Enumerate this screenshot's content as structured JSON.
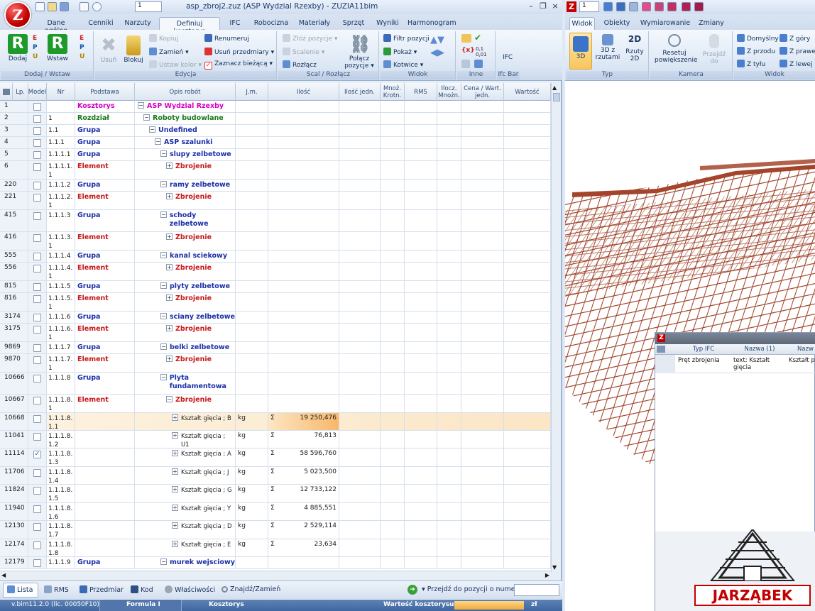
{
  "app": {
    "title": "asp_zbroj2.zuz (ASP Wydzial Rzexby) - ZUZIA11bim",
    "logo": "Z",
    "qat_number": "1"
  },
  "tabs": [
    "Dane ogólne",
    "Cenniki",
    "Narzuty",
    "Definiuj kosztorys",
    "IFC",
    "Robocizna",
    "Materiały",
    "Sprzęt",
    "Wyniki",
    "Harmonogram"
  ],
  "active_tab": "Definiuj kosztorys",
  "ribbon": {
    "groups": [
      "Dodaj / Wstaw",
      "Edycja",
      "Scal / Rozłącz",
      "Widok",
      "Inne",
      "Ifc Bar"
    ],
    "dodaj": "Dodaj",
    "wstaw": "Wstaw",
    "usun": "Usuń",
    "blokuj": "Blokuj",
    "kopiuj": "Kopiuj",
    "zamien": "Zamień",
    "ustaw_kolor": "Ustaw kolor",
    "renumeruj": "Renumeruj",
    "usun_przedmiary": "Usuń przedmiary",
    "zaznacz_biezaca": "Zaznacz bieżącą",
    "zloz_pozycje": "Złóż pozycje",
    "scalenie": "Scalenie",
    "rozlacz": "Rozłącz",
    "polacz_pozycje": "Połącz pozycje",
    "filtr_pozycji": "Filtr pozycji",
    "pokaz": "Pokaż",
    "kotwice": "Kotwice",
    "ifc": "IFC"
  },
  "columns": [
    "Lp.",
    "Model",
    "Nr",
    "Podstawa",
    "Opis robót",
    "J.m.",
    "Ilość",
    "Ilość jedn.",
    "Mnoż. Krotn.",
    "RMS",
    "Ilocz. Mnożn.",
    "Cena / Wart. jedn.",
    "Wartość"
  ],
  "rows": [
    {
      "lp": "1",
      "nr": "",
      "pd": "Kosztorys",
      "op": "ASP Wydzial Rzexby",
      "ind": 0,
      "exp": "⊟",
      "type": "k",
      "jm": "",
      "il": "",
      "chk": false
    },
    {
      "lp": "2",
      "nr": "1",
      "pd": "Rozdział",
      "op": "Roboty budowlane",
      "ind": 1,
      "exp": "⊟",
      "type": "r",
      "jm": "",
      "il": "",
      "chk": false
    },
    {
      "lp": "3",
      "nr": "1.1",
      "pd": "Grupa",
      "op": "Undefined",
      "ind": 2,
      "exp": "⊟",
      "type": "g",
      "jm": "",
      "il": "",
      "chk": false
    },
    {
      "lp": "4",
      "nr": "1.1.1",
      "pd": "Grupa",
      "op": "ASP szalunki",
      "ind": 3,
      "exp": "⊟",
      "type": "g",
      "jm": "",
      "il": "",
      "chk": false
    },
    {
      "lp": "5",
      "nr": "1.1.1.1",
      "pd": "Grupa",
      "op": "slupy zelbetowe",
      "ind": 4,
      "exp": "⊟",
      "type": "g",
      "jm": "",
      "il": "",
      "chk": false
    },
    {
      "lp": "6",
      "nr": "1.1.1.1.1",
      "pd": "Element",
      "op": "Zbrojenie",
      "ind": 5,
      "exp": "⊞",
      "type": "e",
      "jm": "",
      "il": "",
      "chk": false
    },
    {
      "lp": "220",
      "nr": "1.1.1.2",
      "pd": "Grupa",
      "op": "ramy zelbetowe",
      "ind": 4,
      "exp": "⊟",
      "type": "g",
      "jm": "",
      "il": "",
      "chk": false
    },
    {
      "lp": "221",
      "nr": "1.1.1.2.1",
      "pd": "Element",
      "op": "Zbrojenie",
      "ind": 5,
      "exp": "⊞",
      "type": "e",
      "jm": "",
      "il": "",
      "chk": false
    },
    {
      "lp": "415",
      "nr": "1.1.1.3",
      "pd": "Grupa",
      "op": "schody zelbetowe",
      "ind": 4,
      "exp": "⊟",
      "type": "g",
      "jm": "",
      "il": "",
      "chk": false
    },
    {
      "lp": "416",
      "nr": "1.1.1.3.1",
      "pd": "Element",
      "op": "Zbrojenie",
      "ind": 5,
      "exp": "⊞",
      "type": "e",
      "jm": "",
      "il": "",
      "chk": false
    },
    {
      "lp": "555",
      "nr": "1.1.1.4",
      "pd": "Grupa",
      "op": "kanal sciekowy",
      "ind": 4,
      "exp": "⊟",
      "type": "g",
      "jm": "",
      "il": "",
      "chk": false
    },
    {
      "lp": "556",
      "nr": "1.1.1.4.1",
      "pd": "Element",
      "op": "Zbrojenie",
      "ind": 5,
      "exp": "⊞",
      "type": "e",
      "jm": "",
      "il": "",
      "chk": false
    },
    {
      "lp": "815",
      "nr": "1.1.1.5",
      "pd": "Grupa",
      "op": "plyty zelbetowe",
      "ind": 4,
      "exp": "⊟",
      "type": "g",
      "jm": "",
      "il": "",
      "chk": false
    },
    {
      "lp": "816",
      "nr": "1.1.1.5.1",
      "pd": "Element",
      "op": "Zbrojenie",
      "ind": 5,
      "exp": "⊞",
      "type": "e",
      "jm": "",
      "il": "",
      "chk": false
    },
    {
      "lp": "3174",
      "nr": "1.1.1.6",
      "pd": "Grupa",
      "op": "sciany zelbetowe",
      "ind": 4,
      "exp": "⊟",
      "type": "g",
      "jm": "",
      "il": "",
      "chk": false
    },
    {
      "lp": "3175",
      "nr": "1.1.1.6.1",
      "pd": "Element",
      "op": "Zbrojenie",
      "ind": 5,
      "exp": "⊞",
      "type": "e",
      "jm": "",
      "il": "",
      "chk": false
    },
    {
      "lp": "9869",
      "nr": "1.1.1.7",
      "pd": "Grupa",
      "op": "belki zelbetowe",
      "ind": 4,
      "exp": "⊟",
      "type": "g",
      "jm": "",
      "il": "",
      "chk": false
    },
    {
      "lp": "9870",
      "nr": "1.1.1.7.1",
      "pd": "Element",
      "op": "Zbrojenie",
      "ind": 5,
      "exp": "⊞",
      "type": "e",
      "jm": "",
      "il": "",
      "chk": false
    },
    {
      "lp": "10666",
      "nr": "1.1.1.8",
      "pd": "Grupa",
      "op": "Plyta fundamentowa",
      "ind": 4,
      "exp": "⊟",
      "type": "g",
      "jm": "",
      "il": "",
      "chk": false
    },
    {
      "lp": "10667",
      "nr": "1.1.1.8.1",
      "pd": "Element",
      "op": "Zbrojenie",
      "ind": 5,
      "exp": "⊟",
      "type": "e",
      "jm": "",
      "il": "",
      "chk": false
    },
    {
      "lp": "10668",
      "nr": "1.1.1.8.1.1",
      "pd": "",
      "op": "Kształt gięcia ; B",
      "ind": 6,
      "exp": "⊞",
      "type": "p",
      "jm": "kg",
      "il": "19 250,476",
      "chk": false,
      "sel": true
    },
    {
      "lp": "11041",
      "nr": "1.1.1.8.1.2",
      "pd": "",
      "op": "Kształt gięcia ; U1",
      "ind": 6,
      "exp": "⊞",
      "type": "p",
      "jm": "kg",
      "il": "76,813",
      "chk": false
    },
    {
      "lp": "11114",
      "nr": "1.1.1.8.1.3",
      "pd": "",
      "op": "Kształt gięcia ; A",
      "ind": 6,
      "exp": "⊞",
      "type": "p",
      "jm": "kg",
      "il": "58 596,760",
      "chk": true
    },
    {
      "lp": "11706",
      "nr": "1.1.1.8.1.4",
      "pd": "",
      "op": "Kształt gięcia ; J",
      "ind": 6,
      "exp": "⊞",
      "type": "p",
      "jm": "kg",
      "il": "5 023,500",
      "chk": false
    },
    {
      "lp": "11824",
      "nr": "1.1.1.8.1.5",
      "pd": "",
      "op": "Kształt gięcia ; G",
      "ind": 6,
      "exp": "⊞",
      "type": "p",
      "jm": "kg",
      "il": "12 733,122",
      "chk": false
    },
    {
      "lp": "11940",
      "nr": "1.1.1.8.1.6",
      "pd": "",
      "op": "Kształt gięcia ; Y",
      "ind": 6,
      "exp": "⊞",
      "type": "p",
      "jm": "kg",
      "il": "4 885,551",
      "chk": false
    },
    {
      "lp": "12130",
      "nr": "1.1.1.8.1.7",
      "pd": "",
      "op": "Kształt gięcia ; D",
      "ind": 6,
      "exp": "⊞",
      "type": "p",
      "jm": "kg",
      "il": "2 529,114",
      "chk": false
    },
    {
      "lp": "12174",
      "nr": "1.1.1.8.1.8",
      "pd": "",
      "op": "Kształt gięcia ; E",
      "ind": 6,
      "exp": "⊞",
      "type": "p",
      "jm": "kg",
      "il": "23,634",
      "chk": false
    },
    {
      "lp": "12179",
      "nr": "1.1.1.9",
      "pd": "Grupa",
      "op": "murek wejsciowy",
      "ind": 4,
      "exp": "⊟",
      "type": "g",
      "jm": "",
      "il": "",
      "chk": false
    }
  ],
  "sigma": "Σ",
  "bottom": {
    "lista": "Lista",
    "rms": "RMS",
    "przedmiar": "Przedmiar",
    "kod": "Kod",
    "wlasciwosci": "Właściwości",
    "znajdz": "Znajdź/Zamień",
    "przejdz": "Przejdź do pozycji o numerze:"
  },
  "status": {
    "version": "v.bim11.2.0 (lic. 00050F10)",
    "formula": "Formula I",
    "kosztorys": "Kosztorys",
    "wartosc": "Wartość kosztorysu:",
    "zl": "zł"
  },
  "right": {
    "qat_number": "1",
    "tabs": [
      "Widok",
      "Obiekty",
      "Wymiarowanie",
      "Zmiany"
    ],
    "active_tab": "Widok",
    "btn_3d": "3D",
    "btn_3dz": "3D z rzutami",
    "btn_rzuty": "Rzuty 2D",
    "btn_resetuj": "Resetuj powiększenie",
    "btn_przejdz": "Przejdź do",
    "groups": [
      "Typ",
      "Kamera",
      "Widok"
    ],
    "views": [
      "Domyślny",
      "Z przodu",
      "Z tyłu",
      "Z góry",
      "Z prawej",
      "Z lewej"
    ],
    "panel_cols": [
      "Typ IFC",
      "Nazwa (1)",
      "Nazw"
    ],
    "panel_row": [
      "Pręt zbrojenia",
      "text: Kształt gięcia",
      "Kształt pr"
    ],
    "brand": "JARZĄBEK"
  },
  "colors": {
    "kosztorys": "#d400c0",
    "rozdzial": "#167a16",
    "grupa": "#1a2fa8",
    "element": "#c81818",
    "highlight": "#fbd9a8"
  }
}
